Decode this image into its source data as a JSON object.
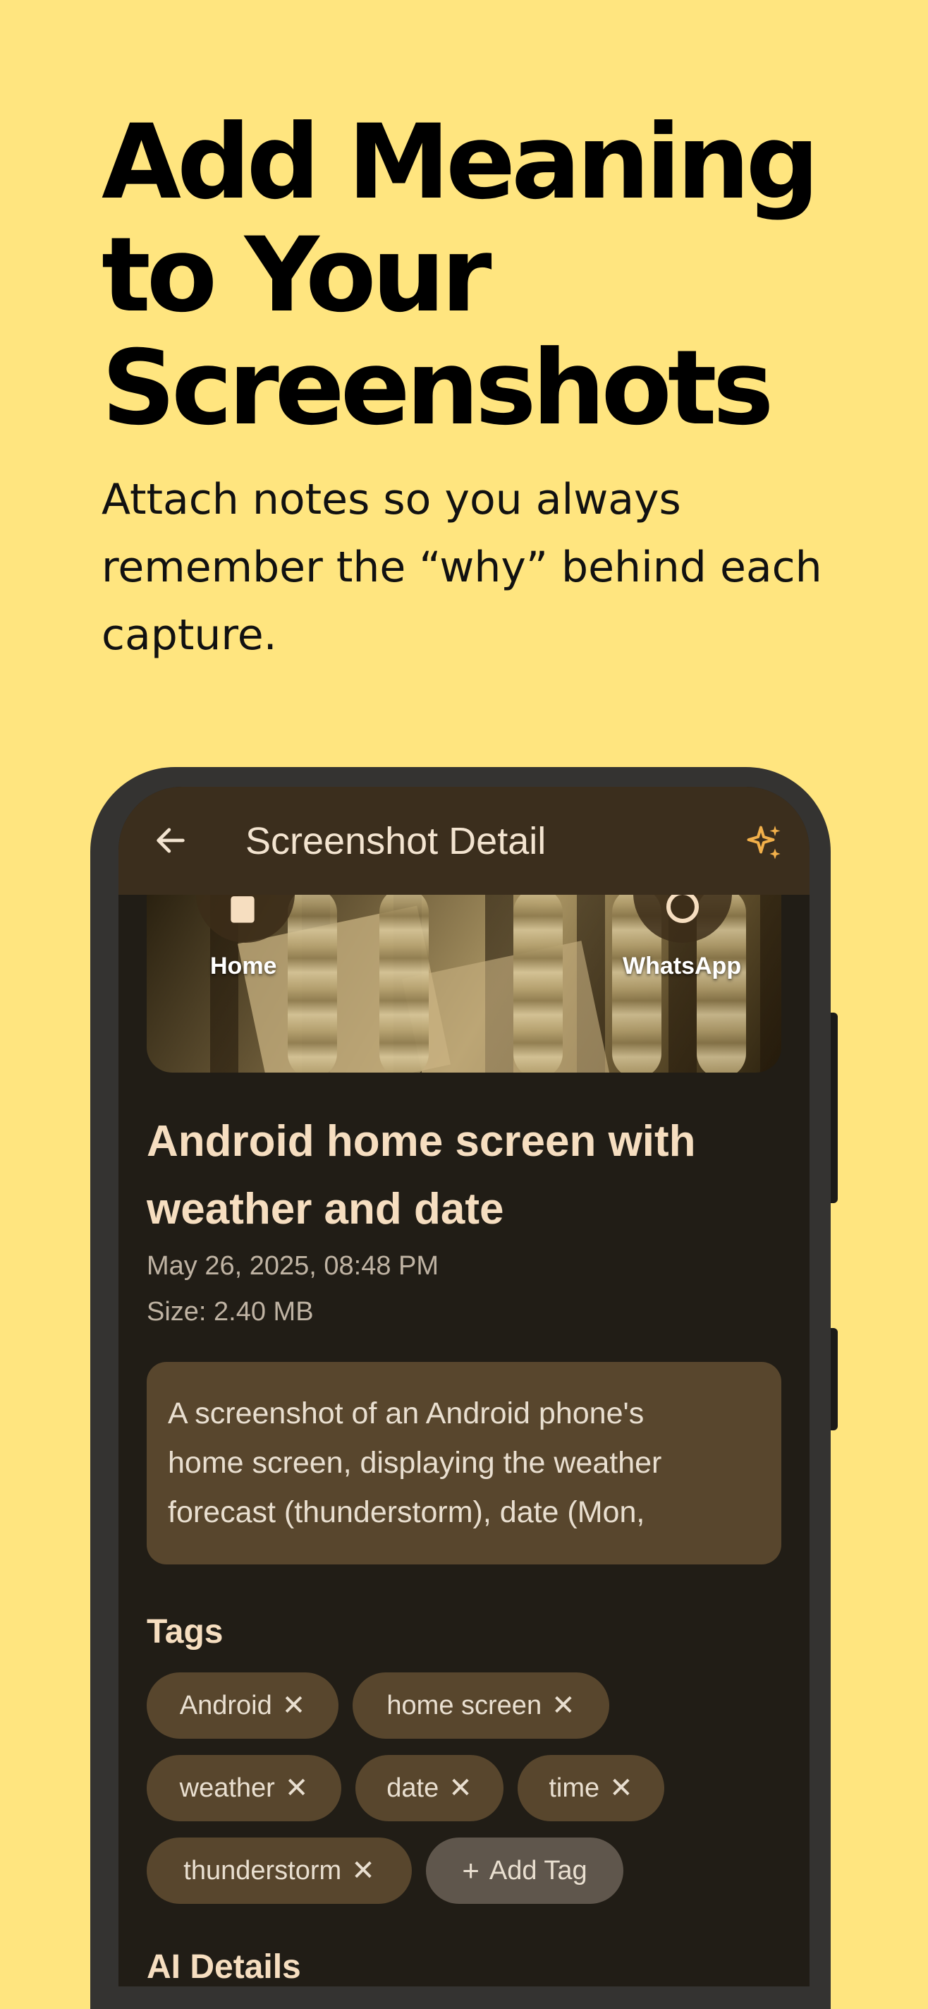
{
  "headline": {
    "line1": "Add Meaning",
    "line2": "to Your",
    "line3": "Screenshots"
  },
  "subtitle": {
    "line1": "Attach notes so you always",
    "line2": "remember the “why” behind each",
    "line3": "capture."
  },
  "app": {
    "topbar": {
      "title": "Screenshot Detail",
      "back_icon": "arrow-left-icon",
      "action_icon": "sparkle-icon"
    },
    "hero": {
      "apps": [
        {
          "label": "Home"
        },
        {
          "label": "WhatsApp"
        }
      ]
    },
    "detail": {
      "title_line1": "Android home screen with",
      "title_line2": "weather and date",
      "date": "May 26, 2025, 08:48 PM",
      "size": "Size: 2.40 MB",
      "description_lines": [
        "A screenshot of an Android phone's",
        "home screen, displaying the weather",
        "forecast (thunderstorm), date (Mon,"
      ]
    },
    "tags": {
      "heading": "Tags",
      "items": [
        "Android",
        "home screen",
        "weather",
        "date",
        "time",
        "thunderstorm"
      ],
      "remove_symbol": "✕",
      "add_label": "Add Tag",
      "add_symbol": "+"
    },
    "next_section_heading": "AI Details"
  },
  "colors": {
    "background": "#FFE57F",
    "screen": "#211d16",
    "topbar": "#3b2e1d",
    "chip": "#58462d",
    "accent_title": "#f6dec0",
    "sparkle": "#f2b04a"
  }
}
